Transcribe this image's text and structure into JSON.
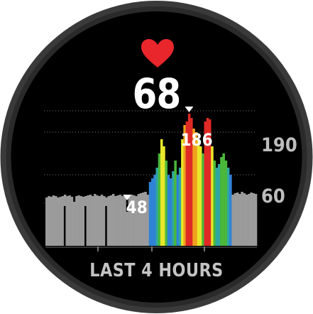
{
  "watch_face": {
    "heart_icon": "heart-icon",
    "heart_color": "#e8262b",
    "current_hr": "68",
    "scale_high": "190",
    "scale_low": "60",
    "max_label": "186",
    "min_label": "48",
    "footer": "LAST 4 HOURS"
  },
  "colors": {
    "gray": "#9b9b9b",
    "blue": "#2f83d6",
    "teal": "#2fa7a2",
    "green": "#4bb83a",
    "yellow": "#e8e82a",
    "orange": "#f0a21e",
    "red": "#e02a26"
  },
  "chart_data": {
    "type": "bar",
    "title": "",
    "xlabel": "LAST 4 HOURS",
    "ylabel": "",
    "ylim": [
      0,
      200
    ],
    "y_reference_lines": [
      60,
      190
    ],
    "max": 186,
    "min": 48,
    "zone_colors": [
      "gray",
      "blue",
      "teal",
      "green",
      "yellow",
      "orange",
      "red"
    ],
    "values": [
      68,
      70,
      69,
      71,
      70,
      68,
      69,
      70,
      72,
      70,
      71,
      69,
      62,
      70,
      71,
      70,
      69,
      70,
      71,
      72,
      70,
      73,
      71,
      70,
      72,
      70,
      68,
      70,
      71,
      73,
      70,
      71,
      72,
      70,
      69,
      48,
      70,
      72,
      71,
      70,
      73,
      74,
      75,
      76,
      72,
      90,
      95,
      100,
      110,
      130,
      150,
      140,
      120,
      100,
      95,
      105,
      120,
      100,
      110,
      150,
      170,
      175,
      186,
      180,
      165,
      160,
      150,
      140,
      130,
      175,
      180,
      178,
      140,
      120,
      110,
      115,
      125,
      130,
      120,
      110,
      100,
      72,
      74,
      75,
      73,
      76,
      74,
      72,
      73,
      75,
      74,
      73
    ]
  }
}
